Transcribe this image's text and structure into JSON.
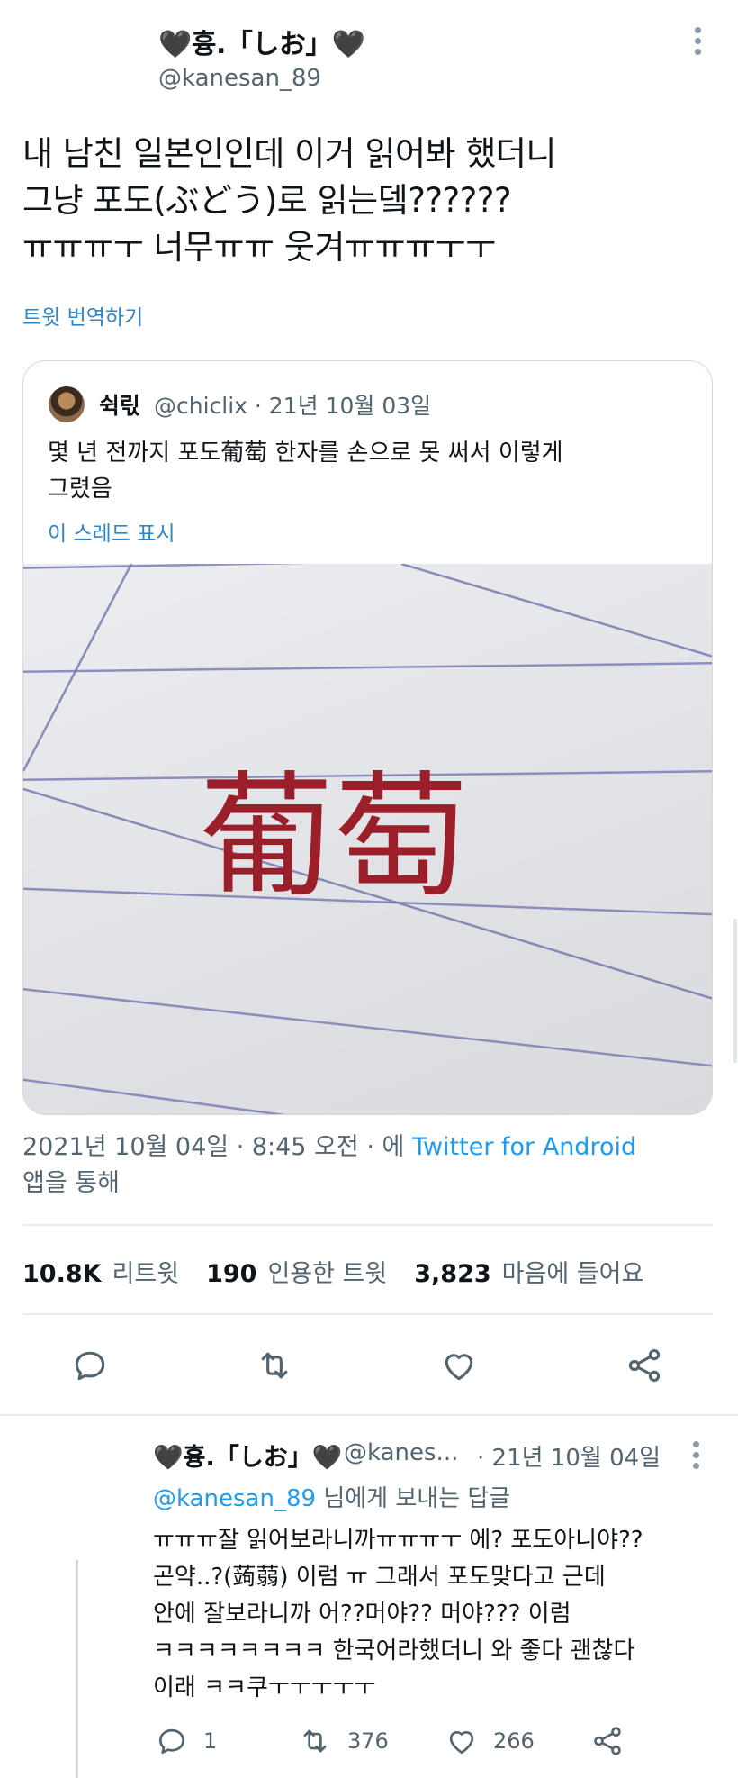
{
  "tweet": {
    "display_name": "🖤흉.「しお」🖤",
    "handle": "@kanesan_89",
    "text_lines": [
      "내 남친 일본인인데 이거 읽어봐 했더니",
      "그냥 포도(ぶどう)로 읽는뎈??????",
      "ㅠㅠㅠㅜ 너무ㅠㅠ 웃겨ㅠㅠㅠㅜㅜ"
    ],
    "translate_label": "트윗 번역하기",
    "timestamp": "2021년 10월 04일 · 8:45 오전 · 에",
    "via_app": "Twitter for Android",
    "via_suffix": "앱을 통해"
  },
  "quote": {
    "display_name": "쉭릯",
    "handle_date": "@chiclix · 21년 10월 03일",
    "text_lines": [
      "몇 년 전까지 포도葡萄 한자를 손으로 못 써서 이렇게",
      "그렸음"
    ],
    "show_thread": "이 스레드 표시",
    "handwritten_chars": "葡萄"
  },
  "stats": {
    "retweets_num": "10.8K",
    "retweets_label": "리트윗",
    "quotes_num": "190",
    "quotes_label": "인용한 트윗",
    "likes_num": "3,823",
    "likes_label": "마음에 들어요"
  },
  "actions": [
    "reply-icon",
    "retweet-icon",
    "like-icon",
    "share-icon"
  ],
  "reply": {
    "display_name": "🖤흉.「しお」🖤",
    "handle": "@kanes...",
    "date": "· 21년 10월 04일",
    "replying_to_handle": "@kanesan_89",
    "replying_to_suffix": "님에게 보내는 답글",
    "text_lines": [
      "ㅠㅠㅠ잘 읽어보라니까ㅠㅠㅠㅜ 에? 포도아니야??",
      "곤약..?(蒟蒻) 이럼 ㅠ 그래서 포도맞다고 근데",
      "안에 잘보라니까 어??머야?? 머야??? 이럼",
      "ㅋㅋㅋㅋㅋㅋㅋㅋ 한국어라했더니 와 좋다 괜찮다",
      "이래 ㅋㅋ쿠ㅜㅜㅜㅜㅜ"
    ],
    "reply_count": "1",
    "retweet_count": "376",
    "like_count": "266"
  },
  "colors": {
    "link": "#1d9bf0",
    "secondary_text": "#536471",
    "divider": "#e6ecf0",
    "ink": "#9a1f2a"
  }
}
